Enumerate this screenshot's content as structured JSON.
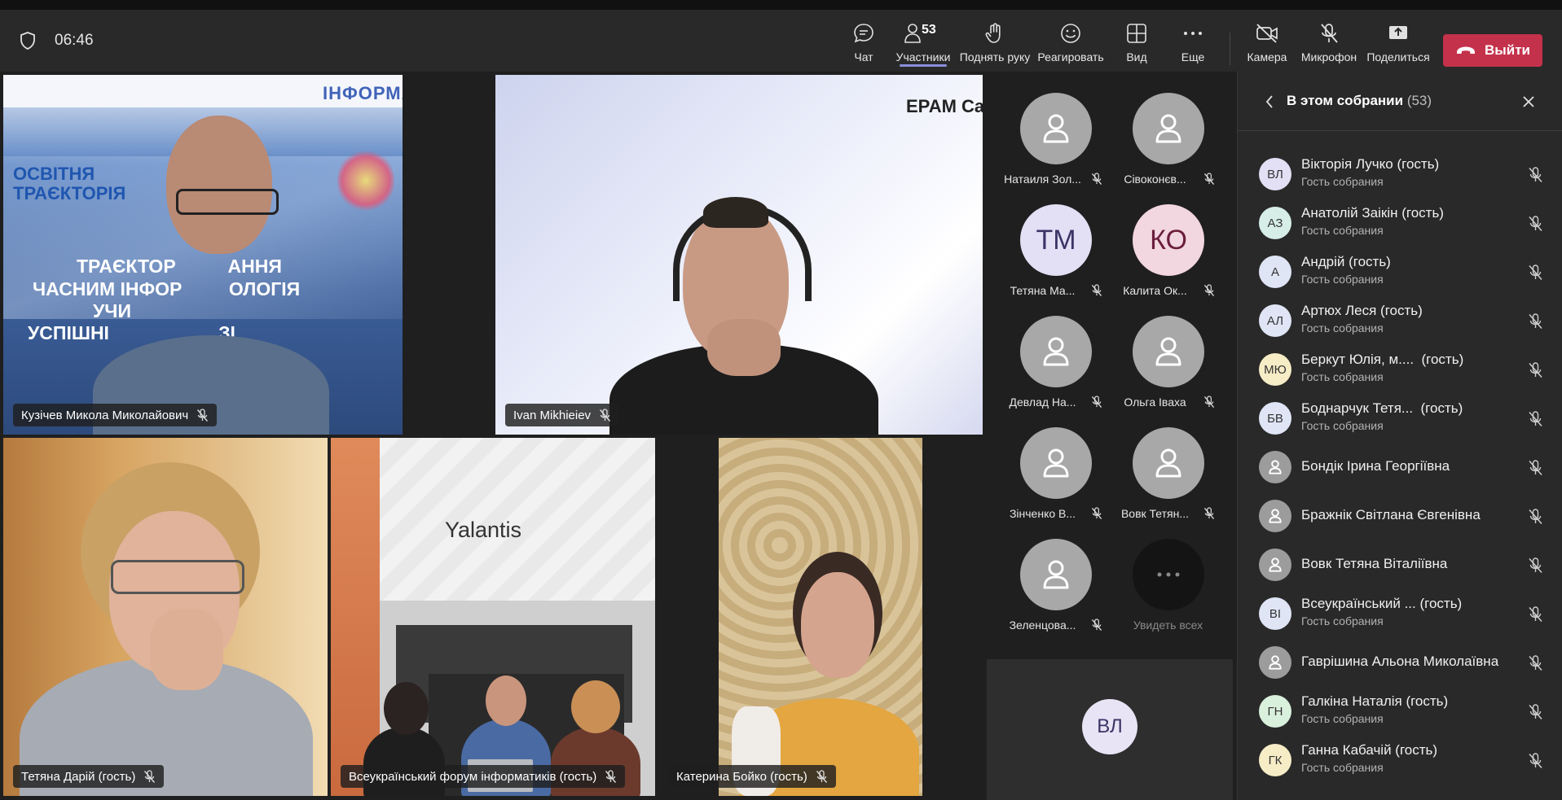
{
  "toolbar": {
    "time": "06:46",
    "participants_count": "53",
    "buttons": {
      "chat": "Чат",
      "participants": "Участники",
      "raise_hand": "Поднять руку",
      "react": "Реагировать",
      "view": "Вид",
      "more": "Еще",
      "camera": "Камера",
      "microphone": "Микрофон",
      "share": "Поделиться",
      "leave": "Выйти"
    }
  },
  "stage": {
    "tiles": [
      {
        "name": "Кузічев Микола Миколайович"
      },
      {
        "name": "Ivan Mikhieiev"
      },
      {
        "name": "Тетяна Дарій (гость)"
      },
      {
        "name": "Всеукраїнський форум інформатиків (гость)"
      },
      {
        "name": "Катерина Бойко (гость)"
      }
    ],
    "banner": {
      "line_a": "ОСВІТНЯ",
      "line_b": "ТРАЄКТОРІЯ",
      "top_word": "ІНФОРМАТИ",
      "row1": "ТРАЄКТОР          АННЯ",
      "row2": "ЧАСНИМ ІНФОР         ОЛОГІЯ",
      "row3": "УЧИ",
      "row4": "УСПІШНІ                     ЗІ"
    },
    "epam_text": "EPAM Ca",
    "yalantis_text": "Yalantis"
  },
  "gallery": {
    "items": [
      {
        "name": "Натаиля Зол...",
        "initials": ""
      },
      {
        "name": "Сівоконєв...",
        "initials": ""
      },
      {
        "name": "Тетяна Ма...",
        "initials": "ТМ"
      },
      {
        "name": "Калита Ок...",
        "initials": "КО"
      },
      {
        "name": "Девлад На...",
        "initials": ""
      },
      {
        "name": "Ольга Іваха",
        "initials": ""
      },
      {
        "name": "Зінченко В...",
        "initials": ""
      },
      {
        "name": "Вовк Тетян...",
        "initials": ""
      },
      {
        "name": "Зеленцова...",
        "initials": ""
      }
    ],
    "see_all": "Увидеть всех",
    "self_initials": "ВЛ"
  },
  "panel": {
    "title": "В этом собрании",
    "count": "(53)",
    "participants": [
      {
        "initials": "ВЛ",
        "name": "Вікторія Лучко (гость)",
        "role": "Гость собрания",
        "color": "#e3dff5"
      },
      {
        "initials": "АЗ",
        "name": "Анатолій Заікін (гость)",
        "role": "Гость собрания",
        "color": "#d6eee7"
      },
      {
        "initials": "А",
        "name": "Андрій (гость)",
        "role": "Гость собрания",
        "color": "#dfe5f5"
      },
      {
        "initials": "АЛ",
        "name": "Артюх Леся (гость)",
        "role": "Гость собрания",
        "color": "#dfe5f5"
      },
      {
        "initials": "МЮ",
        "name": "Беркут Юлія, м....  (гость)",
        "role": "Гость собрания",
        "color": "#f6ecc6"
      },
      {
        "initials": "БВ",
        "name": "Боднарчук Тетя...  (гость)",
        "role": "Гость собрания",
        "color": "#dfe5f5"
      },
      {
        "initials": "",
        "name": "Бондік Ірина Георгіївна",
        "role": "",
        "color": ""
      },
      {
        "initials": "",
        "name": "Бражнік Світлана Євгенівна",
        "role": "",
        "color": ""
      },
      {
        "initials": "",
        "name": "Вовк Тетяна Віталіївна",
        "role": "",
        "color": ""
      },
      {
        "initials": "ВІ",
        "name": "Всеукраїнський ... (гость)",
        "role": "Гость собрания",
        "color": "#dfe5f5"
      },
      {
        "initials": "",
        "name": "Гаврішина Альона Миколаївна",
        "role": "",
        "color": ""
      },
      {
        "initials": "ГН",
        "name": "Галкіна Наталія (гость)",
        "role": "Гость собрания",
        "color": "#d9f0dc"
      },
      {
        "initials": "ГК",
        "name": "Ганна Кабачій (гость)",
        "role": "Гость собрания",
        "color": "#f6ecc6"
      }
    ]
  }
}
